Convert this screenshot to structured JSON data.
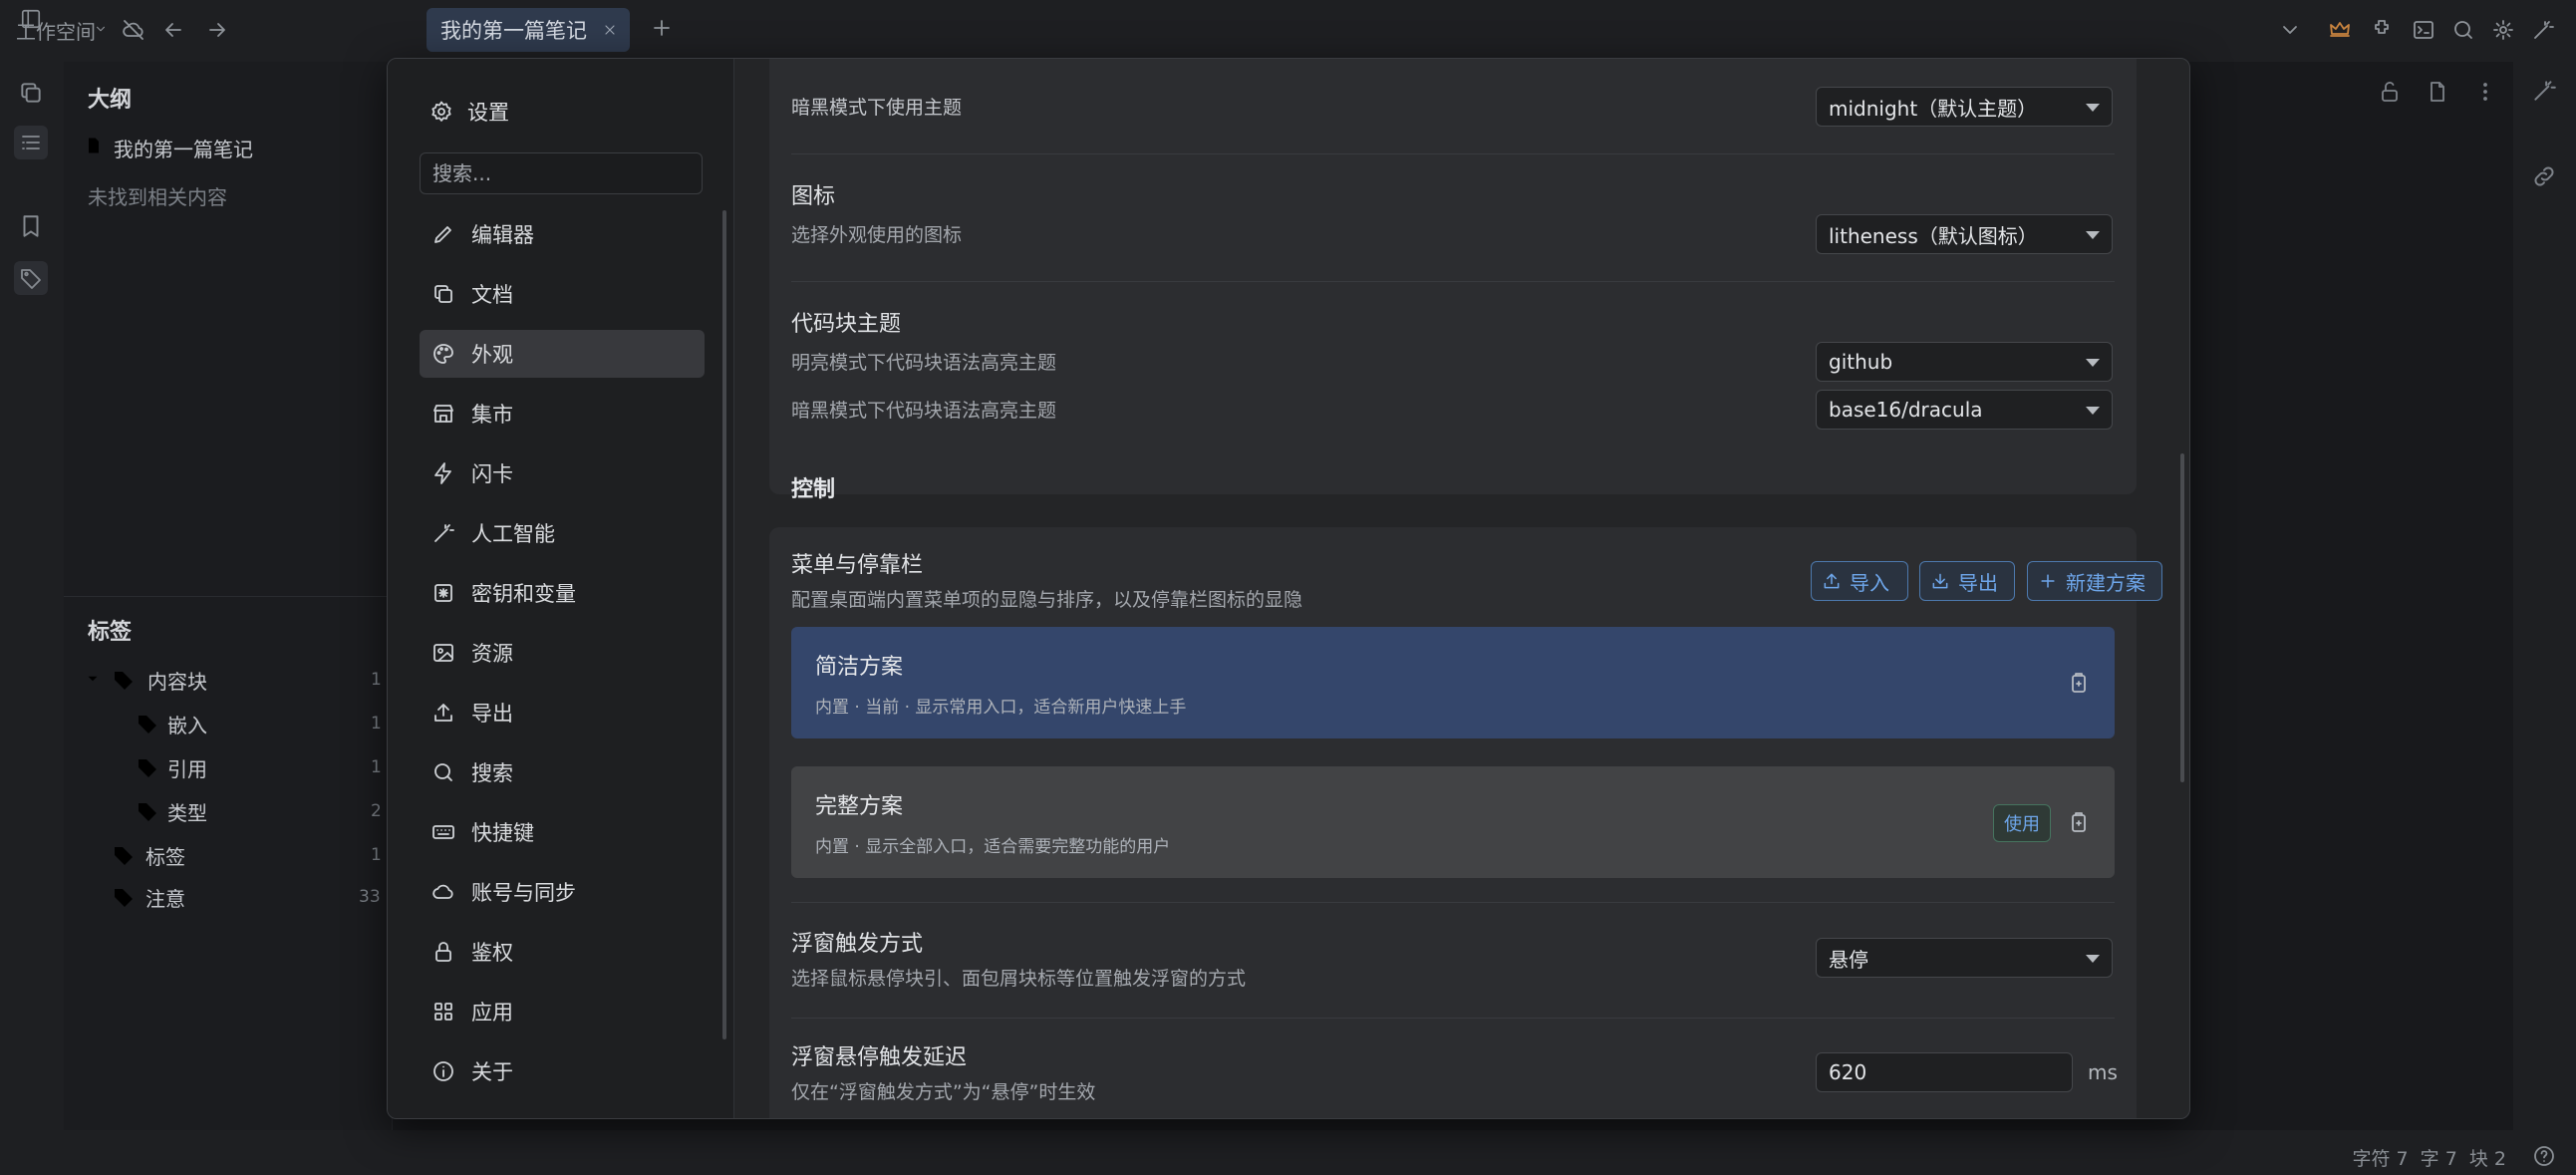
{
  "titlebar": {
    "workspace": "工作空间",
    "tab_label": "我的第一篇笔记"
  },
  "outline": {
    "heading": "大纲",
    "doc_title": "我的第一篇笔记",
    "empty_text": "未找到相关内容"
  },
  "tags": {
    "heading": "标签",
    "items": [
      {
        "label": "内容块",
        "count": "1"
      },
      {
        "label": "嵌入",
        "count": "1"
      },
      {
        "label": "引用",
        "count": "1"
      },
      {
        "label": "类型",
        "count": "2"
      },
      {
        "label": "标签",
        "count": "1"
      },
      {
        "label": "注意",
        "count": "33"
      }
    ]
  },
  "status": {
    "text": "字符 7  字 7  块 2"
  },
  "settings": {
    "title": "设置",
    "search_placeholder": "搜索...",
    "nav": [
      {
        "label": "编辑器",
        "icon": "pencil-icon"
      },
      {
        "label": "文档",
        "icon": "copy-icon"
      },
      {
        "label": "外观",
        "icon": "palette-icon"
      },
      {
        "label": "集市",
        "icon": "store-icon"
      },
      {
        "label": "闪卡",
        "icon": "bolt-icon"
      },
      {
        "label": "人工智能",
        "icon": "magic-wand-icon"
      },
      {
        "label": "密钥和变量",
        "icon": "key-box-icon"
      },
      {
        "label": "资源",
        "icon": "image-icon"
      },
      {
        "label": "导出",
        "icon": "export-icon"
      },
      {
        "label": "搜索",
        "icon": "search-icon"
      },
      {
        "label": "快捷键",
        "icon": "keyboard-icon"
      },
      {
        "label": "账号与同步",
        "icon": "cloud-icon"
      },
      {
        "label": "鉴权",
        "icon": "lock-icon"
      },
      {
        "label": "应用",
        "icon": "grid-icon"
      },
      {
        "label": "关于",
        "icon": "info-icon"
      }
    ],
    "appearance": {
      "dark_theme_label": "暗黑模式下使用主题",
      "dark_theme_value": "midnight（默认主题）",
      "icon_title": "图标",
      "icon_desc": "选择外观使用的图标",
      "icon_value": "litheness（默认图标）",
      "code_title": "代码块主题",
      "code_light_desc": "明亮模式下代码块语法高亮主题",
      "code_light_value": "github",
      "code_dark_desc": "暗黑模式下代码块语法高亮主题",
      "code_dark_value": "base16/dracula"
    },
    "control": {
      "section_title": "控制",
      "menu_title": "菜单与停靠栏",
      "menu_desc": "配置桌面端内置菜单项的显隐与排序，以及停靠栏图标的显隐",
      "import_label": "导入",
      "export_label": "导出",
      "new_plan_label": "新建方案",
      "plan_simple_title": "简洁方案",
      "plan_simple_desc": "内置 · 当前 · 显示常用入口，适合新用户快速上手",
      "plan_full_title": "完整方案",
      "plan_full_desc": "内置 · 显示全部入口，适合需要完整功能的用户",
      "use_label": "使用",
      "float_title": "浮窗触发方式",
      "float_desc": "选择鼠标悬停块引、面包屑块标等位置触发浮窗的方式",
      "float_value": "悬停",
      "delay_title": "浮窗悬停触发延迟",
      "delay_desc": "仅在“浮窗触发方式”为“悬停”时生效",
      "delay_value": "620",
      "delay_unit": "ms"
    },
    "colors": {
      "selected_plan_bg": "#34466b",
      "plan_bg": "#424345",
      "accent": "#6ea6ea"
    }
  }
}
